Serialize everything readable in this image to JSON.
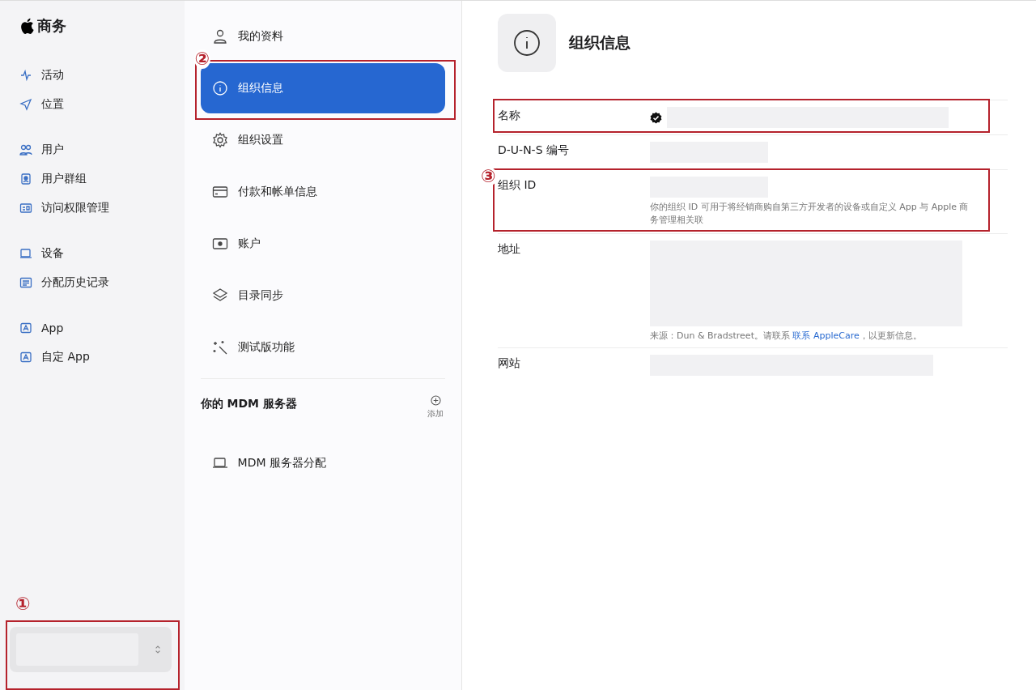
{
  "sidebar": {
    "brand": "商务",
    "groups": [
      [
        {
          "label": "活动"
        },
        {
          "label": "位置"
        }
      ],
      [
        {
          "label": "用户"
        },
        {
          "label": "用户群组"
        },
        {
          "label": "访问权限管理"
        }
      ],
      [
        {
          "label": "设备"
        },
        {
          "label": "分配历史记录"
        }
      ],
      [
        {
          "label": "App"
        },
        {
          "label": "自定 App"
        }
      ]
    ],
    "org_switcher": {
      "annotation": "①"
    }
  },
  "settings_nav": {
    "items": [
      {
        "label": "我的资料",
        "selected": false
      },
      {
        "label": "组织信息",
        "selected": true,
        "annotation": "②"
      },
      {
        "label": "组织设置",
        "selected": false
      },
      {
        "label": "付款和帐单信息",
        "selected": false
      },
      {
        "label": "账户",
        "selected": false
      },
      {
        "label": "目录同步",
        "selected": false
      },
      {
        "label": "测试版功能",
        "selected": false
      }
    ],
    "mdm_section": {
      "title": "你的 MDM 服务器",
      "add_label": "添加",
      "items": [
        {
          "label": "MDM 服务器分配",
          "selected": false
        }
      ]
    }
  },
  "org_info": {
    "title": "组织信息",
    "fields": [
      {
        "label": "名称",
        "kind": "verified",
        "highlighted": true
      },
      {
        "label": "D-U-N-S 编号",
        "kind": "short",
        "highlighted": false
      },
      {
        "label": "组织 ID",
        "kind": "short",
        "highlighted": true,
        "annotation": "③",
        "note": "你的组织 ID 可用于将经销商购自第三方开发者的设备或自定义 App 与 Apple 商务管理相关联"
      },
      {
        "label": "地址",
        "kind": "address",
        "highlighted": false,
        "note_prefix": "来源：Dun & Bradstreet。请联系 ",
        "note_link": "联系 AppleCare",
        "note_suffix": "，以更新信息。"
      },
      {
        "label": "网站",
        "kind": "wide",
        "highlighted": false
      }
    ]
  }
}
